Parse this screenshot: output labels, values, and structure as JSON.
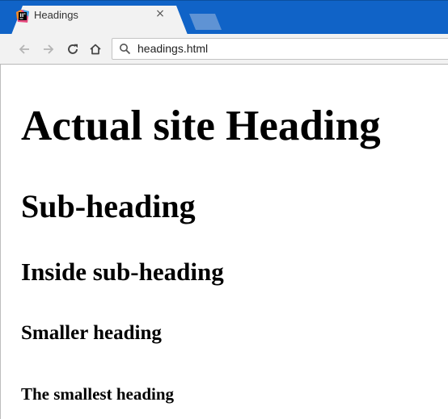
{
  "browser": {
    "tab": {
      "title": "Headings",
      "close_glyph": "×",
      "favicon": "intellij-icon"
    },
    "toolbar": {
      "back_icon": "back-arrow-icon",
      "forward_icon": "forward-arrow-icon",
      "reload_icon": "reload-icon",
      "home_icon": "home-icon"
    },
    "address_bar": {
      "value": "headings.html",
      "icon": "search-icon"
    },
    "colors": {
      "tabstrip": "#1063c7",
      "toolbar": "#f2f2f2"
    }
  },
  "page": {
    "h1": "Actual site Heading",
    "h2": "Sub-heading",
    "h3": "Inside sub-heading",
    "h4": "Smaller heading",
    "h5": "The smallest heading"
  }
}
